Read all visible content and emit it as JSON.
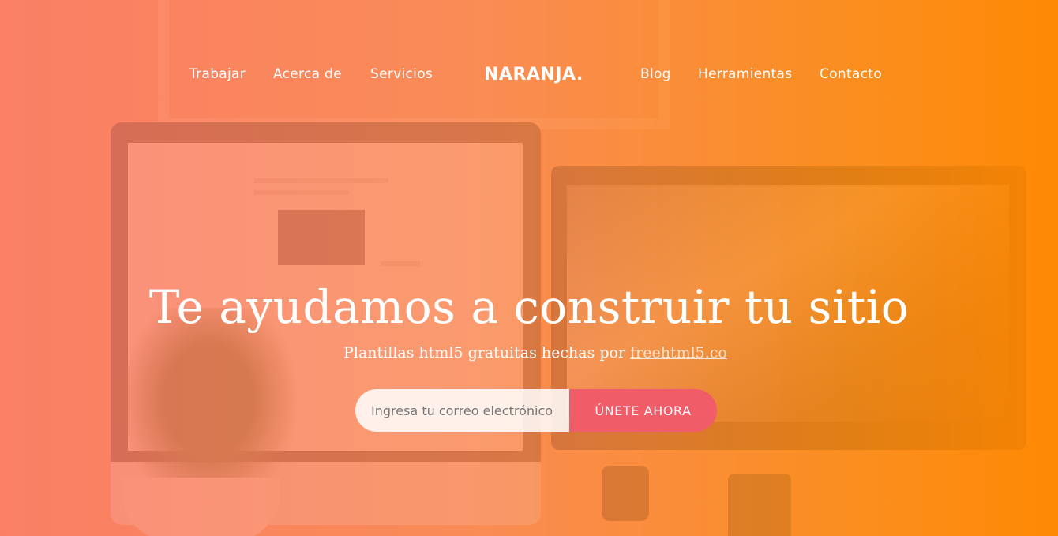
{
  "nav": {
    "left": [
      {
        "label": "Trabajar"
      },
      {
        "label": "Acerca de"
      },
      {
        "label": "Servicios"
      }
    ],
    "brand": "NARANJA.",
    "right": [
      {
        "label": "Blog"
      },
      {
        "label": "Herramientas"
      },
      {
        "label": "Contacto"
      }
    ]
  },
  "hero": {
    "headline": "Te ayudamos a construir tu sitio",
    "subtitle_prefix": "Plantillas html5 gratuitas hechas por",
    "subtitle_link": "freehtml5.co"
  },
  "signup": {
    "placeholder": "Ingresa tu correo electrónico",
    "button_label": "ÚNETE AHORA"
  },
  "colors": {
    "overlay_start": "#fc7864",
    "overlay_end": "#ff8800",
    "button": "#f05c68"
  }
}
